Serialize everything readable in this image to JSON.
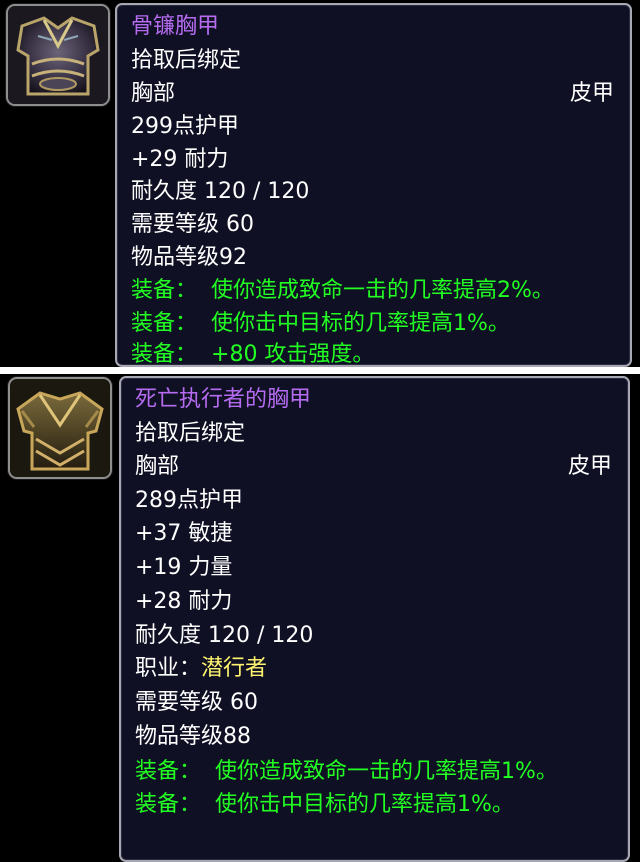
{
  "items": [
    {
      "icon": "bone-chestplate-icon",
      "name": "骨镰胸甲",
      "bind": "拾取后绑定",
      "slot": "胸部",
      "armor_type": "皮甲",
      "armor": "299点护甲",
      "stats": [
        "+29 耐力"
      ],
      "durability": "耐久度 120 / 120",
      "required_level": "需要等级 60",
      "item_level": "物品等级92",
      "equip_effects": [
        {
          "label": "装备：",
          "text": "使你造成致命一击的几率提高2%。"
        },
        {
          "label": "装备：",
          "text": "使你击中目标的几率提高1%。"
        },
        {
          "label": "装备：",
          "text": "+80 攻击强度。"
        }
      ],
      "colors": {
        "name": "#b56cf0",
        "effect": "#22ff22"
      }
    },
    {
      "icon": "deathdealer-breastplate-icon",
      "name": "死亡执行者的胸甲",
      "bind": "拾取后绑定",
      "slot": "胸部",
      "armor_type": "皮甲",
      "armor": "289点护甲",
      "stats": [
        "+37 敏捷",
        "+19 力量",
        "+28 耐力"
      ],
      "durability": "耐久度 120 / 120",
      "class_label": "职业：",
      "class_value": "潜行者",
      "required_level": "需要等级 60",
      "item_level": "物品等级88",
      "equip_effects": [
        {
          "label": "装备：",
          "text": "使你造成致命一击的几率提高1%。"
        },
        {
          "label": "装备：",
          "text": "使你击中目标的几率提高1%。"
        }
      ],
      "colors": {
        "name": "#b56cf0",
        "effect": "#22ff22",
        "class_value": "#fff46e"
      }
    }
  ]
}
